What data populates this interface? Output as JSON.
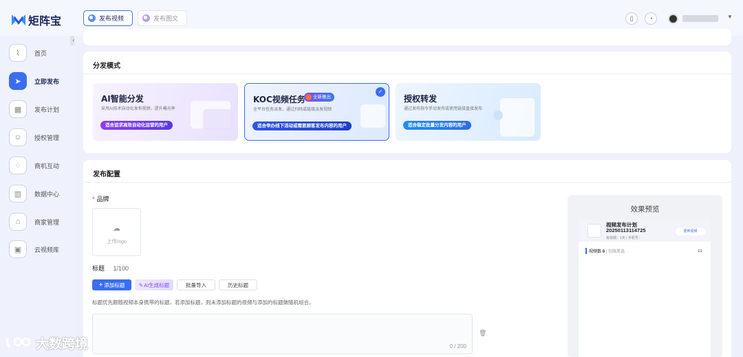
{
  "app": {
    "name": "矩阵宝"
  },
  "top_tabs": [
    {
      "label": "发布视频",
      "active": true
    },
    {
      "label": "发布图文",
      "active": false
    }
  ],
  "sidebar": {
    "items": [
      {
        "label": "首页",
        "icon": "chart-line-icon",
        "active": false
      },
      {
        "label": "立即发布",
        "icon": "send-icon",
        "active": true
      },
      {
        "label": "发布计划",
        "icon": "calendar-icon",
        "active": false
      },
      {
        "label": "授权管理",
        "icon": "user-auth-icon",
        "active": false
      },
      {
        "label": "商机互动",
        "icon": "chat-icon",
        "active": false
      },
      {
        "label": "数据中心",
        "icon": "bar-chart-icon",
        "active": false
      },
      {
        "label": "商家管理",
        "icon": "store-icon",
        "active": false
      },
      {
        "label": "云视频库",
        "icon": "video-library-icon",
        "active": false
      }
    ]
  },
  "distribution": {
    "title": "分发模式",
    "modes": [
      {
        "title": "AI智能分发",
        "desc": "采用AI技术自动化发布视频，提升曝光率",
        "pill": "适合追求高效自动化运营的用户",
        "selected": false
      },
      {
        "title": "KOC视频任务",
        "badge": "全新推出",
        "desc": "全平台任务派发，通过扫码或链接派发视频",
        "pill": "适合举办线下活动或需要顾客发布内容的用户",
        "selected": true
      },
      {
        "title": "授权转发",
        "desc": "通过发布指令手动发布或使用链接直接发布",
        "pill": "适合稳定批量分发内容的用户",
        "selected": false
      }
    ]
  },
  "config": {
    "title": "发布配置",
    "brand_label": "品牌",
    "upload_label": "上传logo",
    "title_label": "标题",
    "title_count": "1/100",
    "buttons": {
      "add": "添加标题",
      "ai": "AI生成标题",
      "batch": "批量导入",
      "history": "历史标题"
    },
    "hint": "标题优先跟随视频本身携带的标题，若添加标题，则未添加标题的视频与添加的标题做随机组合。",
    "counter": "0 / 200"
  },
  "preview": {
    "title": "效果预览",
    "plan_title": "视频发布计划",
    "plan_id": "20250113114725",
    "meta": "有效期：1天 | 手机号：",
    "action": "更新视频",
    "stat_label": "视频数",
    "stat_value": "0",
    "stat_note": "仅限单选"
  },
  "watermark": "大数跨境"
}
